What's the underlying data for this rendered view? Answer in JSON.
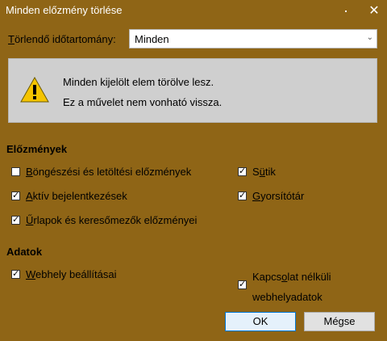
{
  "window": {
    "title": "Minden előzmény törlése",
    "close_glyph": "✕"
  },
  "range": {
    "label_mnemonic": "T",
    "label_rest": "örlendő időtartomány:",
    "value": "Minden",
    "arrow_glyph": "⌄"
  },
  "warning": {
    "line1": "Minden kijelölt elem törölve lesz.",
    "line2": "Ez a művelet nem vonható vissza."
  },
  "history": {
    "heading": "Előzmények",
    "items": [
      {
        "mnemonic": "B",
        "rest": "öngészési és letöltési előzmények",
        "checked": false
      },
      {
        "mnemonic": "A",
        "rest": "ktív bejelentkezések",
        "checked": true
      },
      {
        "mnemonic": "Ű",
        "rest": "rlapok és keresőmezők előzményei",
        "checked": true
      },
      {
        "pre": "S",
        "mnemonic": "ü",
        "rest": "tik",
        "checked": true
      },
      {
        "mnemonic": "G",
        "rest": "yorsítótár",
        "checked": true
      }
    ]
  },
  "data_section": {
    "heading": "Adatok",
    "items": [
      {
        "mnemonic": "W",
        "rest": "ebhely beállításai",
        "checked": true
      },
      {
        "pre": "Kapcs",
        "mnemonic": "o",
        "rest": "lat nélküli",
        "line2": "webhelyadatok",
        "checked": true
      }
    ]
  },
  "buttons": {
    "ok": "OK",
    "cancel": "Mégse"
  },
  "check_glyph": "✓"
}
